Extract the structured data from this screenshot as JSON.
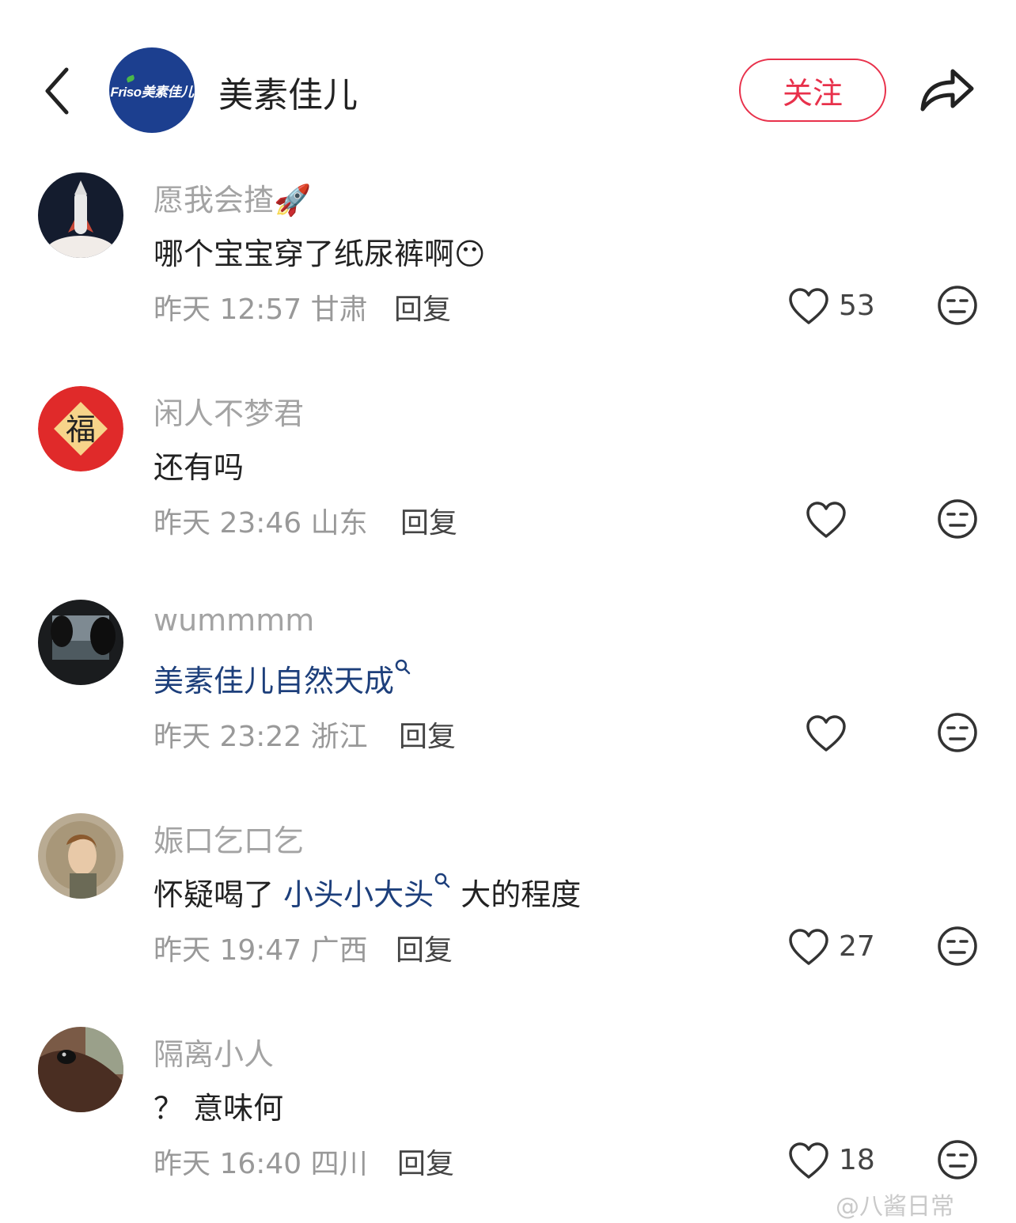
{
  "header": {
    "back_icon": "chevron-left-icon",
    "brand_logo_text": "Friso美素佳儿",
    "title": "美素佳儿",
    "follow_label": "关注",
    "share_icon": "share-arrow-icon"
  },
  "colors": {
    "accent": "#e8314b",
    "link": "#1d3f7b",
    "brand": "#1c3f8f"
  },
  "comments": [
    {
      "name": "愿我会揸🚀",
      "text_plain": "哪个宝宝穿了纸尿裤啊",
      "emoji": "😶",
      "time": "昨天 12:57 甘肃",
      "reply": "回复",
      "likes": "53"
    },
    {
      "name": "闲人不梦君",
      "text_plain": "还有吗",
      "time": "昨天 23:46 山东",
      "reply": "回复",
      "likes": ""
    },
    {
      "name": "wummmm",
      "text_link": "美素佳儿自然天成",
      "time": "昨天 23:22 浙江",
      "reply": "回复",
      "likes": ""
    },
    {
      "name": "娠口乞口乞",
      "text_pre": "怀疑喝了 ",
      "text_link": "小头小大头",
      "text_post": " 大的程度",
      "time": "昨天 19:47 广西",
      "reply": "回复",
      "likes": "27"
    },
    {
      "name": "隔离小人",
      "text_plain": "？ 意味何",
      "time": "昨天 16:40 四川",
      "reply": "回复",
      "likes": "18"
    }
  ],
  "avatar_fu_text": "福",
  "watermark": "@八酱日常"
}
